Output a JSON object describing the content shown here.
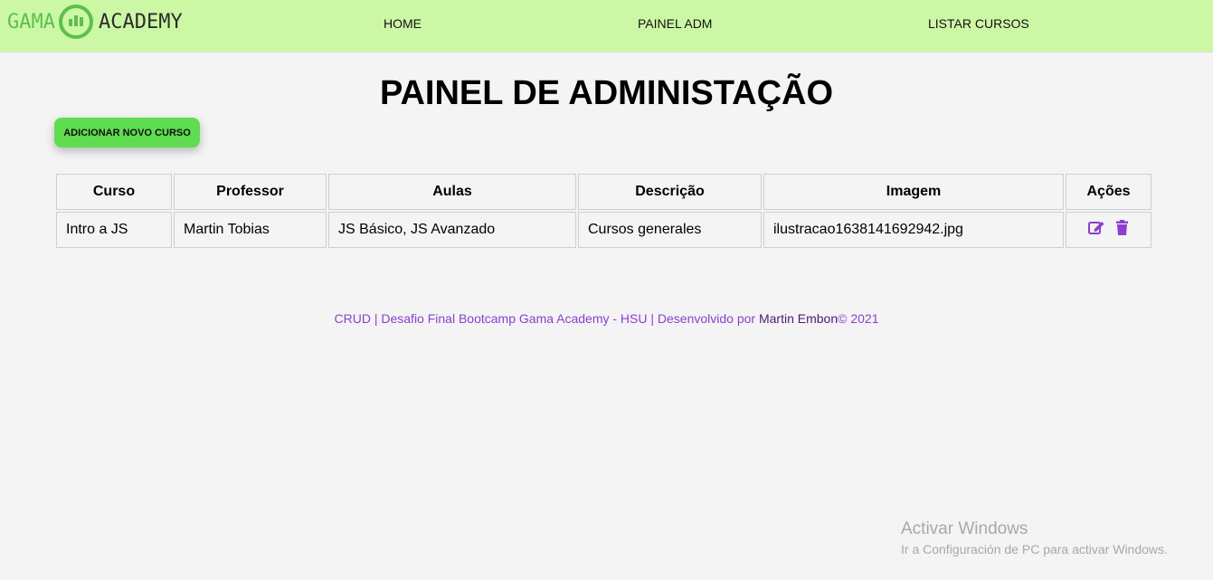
{
  "brand": {
    "left_word": "GAMA",
    "right_word": "ACADEMY",
    "accent_color": "#5cc04a",
    "nav_bg_color": "#ccf8a6"
  },
  "nav": {
    "items": [
      {
        "label": "HOME"
      },
      {
        "label": "PAINEL ADM"
      },
      {
        "label": "LISTAR CURSOS"
      }
    ]
  },
  "page": {
    "title": "PAINEL DE ADMINISTAÇÃO",
    "add_button_label": "ADICIONAR NOVO CURSO",
    "add_button_color": "#5fdc50"
  },
  "table": {
    "headers": [
      "Curso",
      "Professor",
      "Aulas",
      "Descrição",
      "Imagem",
      "Ações"
    ],
    "rows": [
      {
        "curso": "Intro a JS",
        "professor": "Martin Tobias",
        "aulas": "JS Básico, JS Avanzado",
        "descricao": "Cursos generales",
        "imagem": "ilustracao1638141692942.jpg",
        "actions": [
          "edit-icon",
          "trash-icon"
        ]
      }
    ],
    "action_icon_color": "#8a3fd1"
  },
  "footer": {
    "text_before": "CRUD | Desafio Final Bootcamp Gama Academy - HSU | Desenvolvido por ",
    "author": "Martin Embon",
    "text_after": "© 2021",
    "link_color": "#8a3fd1"
  },
  "watermark": {
    "line1": "Activar Windows",
    "line2": "Ir a Configuración de PC para activar Windows."
  }
}
